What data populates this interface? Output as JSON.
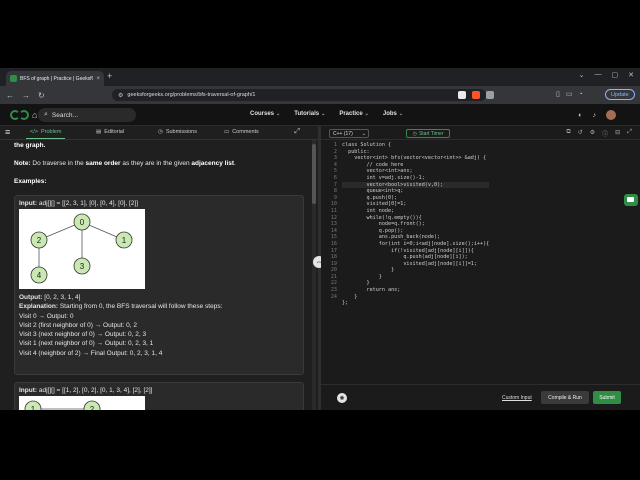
{
  "browser": {
    "tab_title": "BFS of graph | Practice | GeeksfO",
    "tab_close": "×",
    "new_tab": "+",
    "url": "geeksforgeeks.org/problems/bfs-traversal-of-graph/1",
    "update_label": "Update"
  },
  "header": {
    "search_placeholder": "Search...",
    "menu": [
      {
        "label": "Courses"
      },
      {
        "label": "Tutorials"
      },
      {
        "label": "Practice"
      },
      {
        "label": "Jobs"
      }
    ]
  },
  "problem_tabs": [
    {
      "label": "Problem",
      "icon": "code-icon"
    },
    {
      "label": "Editorial",
      "icon": "book-icon"
    },
    {
      "label": "Submissions",
      "icon": "history-icon"
    },
    {
      "label": "Comments",
      "icon": "comment-icon"
    }
  ],
  "problem": {
    "intro_tail": "the graph.",
    "note_label": "Note:",
    "note_text_a": " Do traverse in the ",
    "note_bold_a": "same order",
    "note_text_b": " as they are in the given ",
    "note_bold_b": "adjacency list",
    "note_end": ".",
    "examples_label": "Examples:",
    "example1": {
      "input_label": "Input:",
      "input_value": " adj[][] = [[2, 3, 1], [0], [0, 4], [0], [2]]",
      "nodes": [
        "0",
        "1",
        "2",
        "3",
        "4"
      ],
      "output_label": "Output:",
      "output_value": " [0, 2, 3, 1, 4]",
      "explanation_label": "Explanation:",
      "explanation": " Starting from 0, the BFS traversal will follow these steps:",
      "steps": [
        "Visit 0 → Output: 0",
        "Visit 2 (first neighbor of 0) → Output: 0, 2",
        "Visit 3 (next neighbor of 0) → Output: 0, 2, 3",
        "Visit 1 (next neighbor of 0) → Output: 0, 2, 3, 1",
        "Visit 4 (neighbor of 2) → Final Output: 0, 2, 3, 1, 4"
      ]
    },
    "example2": {
      "input_label": "Input:",
      "input_value": " adj[][] = [[1, 2], [0, 2], [0, 1, 3, 4], [2], [2]]",
      "nodes": [
        "1",
        "2"
      ]
    }
  },
  "editor": {
    "language": "C++ (17)",
    "timer_label": "Start Timer",
    "line_numbers": [
      "1",
      "2",
      "3",
      "4",
      "5",
      "6",
      "7",
      "8",
      "9",
      "10",
      "11",
      "12",
      "13",
      "14",
      "15",
      "16",
      "17",
      "18",
      "19",
      "20",
      "21",
      "22",
      "23",
      "24"
    ],
    "code_lines": [
      "class Solution {",
      "  public:",
      "    vector<int> bfs(vector<vector<int>> &adj) {",
      "        // code here",
      "        vector<int>ans;",
      "        int v=adj.size()-1;",
      "        vector<bool>visited(v,0);",
      "        queue<int>q;",
      "        q.push(0);",
      "        visited[0]=1;",
      "        int node;",
      "        while(!q.empty()){",
      "            node=q.front();",
      "            q.pop();",
      "            ans.push_back(node);",
      "            for(int i=0;i<adj[node].size();i++){",
      "                if(!visited[adj[node][i]]){",
      "                    q.push(adj[node][i]);",
      "                    visited[adj[node][i]]=1;",
      "                }",
      "            }",
      "        }",
      "        return ans;",
      "    }",
      "};"
    ],
    "custom_input": "Custom Input",
    "compile_label": "Compile & Run",
    "submit_label": "Submit"
  },
  "colors": {
    "brand_green": "#2f8d46",
    "background": "#1f1f1f"
  }
}
